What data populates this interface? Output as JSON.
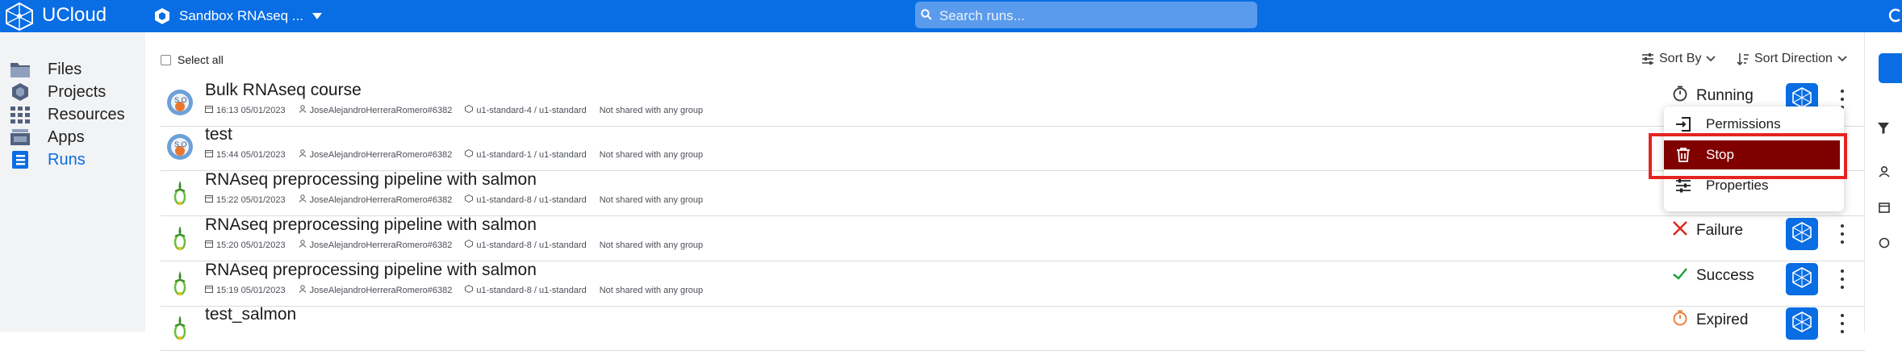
{
  "header": {
    "brand": "UCloud",
    "project": "Sandbox RNAseq ...",
    "search_placeholder": "Search runs...",
    "colors": {
      "primary": "#096de3",
      "stop": "#800000",
      "highlight": "#e52420"
    }
  },
  "sidebar": {
    "items": [
      {
        "label": "Files",
        "icon": "folder-icon"
      },
      {
        "label": "Projects",
        "icon": "hexagon-icon"
      },
      {
        "label": "Resources",
        "icon": "grid-icon"
      },
      {
        "label": "Apps",
        "icon": "apps-icon"
      },
      {
        "label": "Runs",
        "icon": "runs-icon",
        "active": true
      }
    ]
  },
  "toolbar": {
    "select_all": "Select all",
    "sort_by": "Sort By",
    "sort_direction": "Sort Direction"
  },
  "runs": [
    {
      "title": "Bulk RNAseq course",
      "time": "16:13 05/01/2023",
      "user": "JoseAlejandroHerreraRomero#6382",
      "machine": "u1-standard-4 / u1-standard",
      "sharing": "Not shared with any group",
      "state": "Running",
      "app": "rstudio"
    },
    {
      "title": "test",
      "time": "15:44 05/01/2023",
      "user": "JoseAlejandroHerreraRomero#6382",
      "machine": "u1-standard-1 / u1-standard",
      "sharing": "Not shared with any group",
      "state": "",
      "app": "rstudio"
    },
    {
      "title": "RNAseq preprocessing pipeline with salmon",
      "time": "15:22 05/01/2023",
      "user": "JoseAlejandroHerreraRomero#6382",
      "machine": "u1-standard-8 / u1-standard",
      "sharing": "Not shared with any group",
      "state": "",
      "app": "salmon"
    },
    {
      "title": "RNAseq preprocessing pipeline with salmon",
      "time": "15:20 05/01/2023",
      "user": "JoseAlejandroHerreraRomero#6382",
      "machine": "u1-standard-8 / u1-standard",
      "sharing": "Not shared with any group",
      "state": "Failure",
      "app": "salmon"
    },
    {
      "title": "RNAseq preprocessing pipeline with salmon",
      "time": "15:19 05/01/2023",
      "user": "JoseAlejandroHerreraRomero#6382",
      "machine": "u1-standard-8 / u1-standard",
      "sharing": "Not shared with any group",
      "state": "Success",
      "app": "salmon"
    },
    {
      "title": "test_salmon",
      "time": "",
      "user": "",
      "machine": "",
      "sharing": "",
      "state": "Expired",
      "app": "salmon"
    }
  ],
  "dropdown": {
    "items": [
      {
        "label": "Permissions",
        "icon": "permissions-icon"
      },
      {
        "label": "Stop",
        "icon": "trash-icon"
      },
      {
        "label": "Properties",
        "icon": "properties-icon"
      }
    ]
  }
}
